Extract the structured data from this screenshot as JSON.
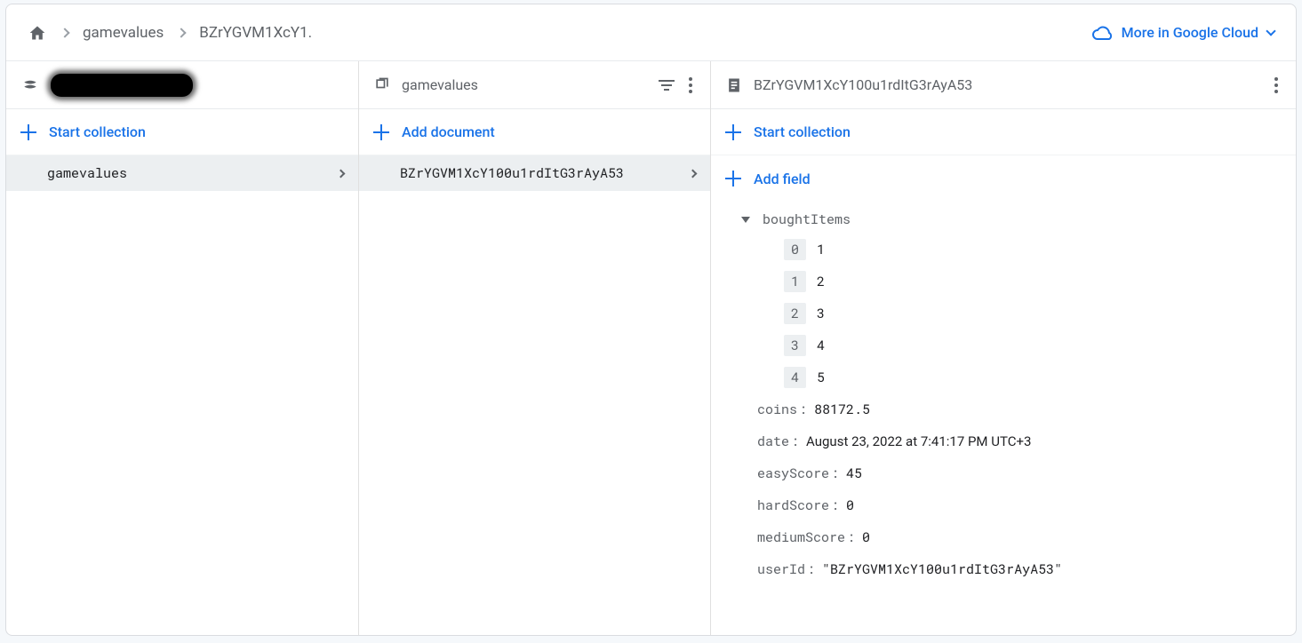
{
  "breadcrumb": {
    "items": [
      "gamevalues",
      "BZrYGVM1XcY1."
    ],
    "more_label": "More in Google Cloud"
  },
  "col1": {
    "action": "Start collection",
    "items": [
      {
        "label": "gamevalues",
        "selected": true
      }
    ]
  },
  "col2": {
    "title": "gamevalues",
    "action": "Add document",
    "items": [
      {
        "label": "BZrYGVM1XcY100u1rdItG3rAyA53",
        "selected": true
      }
    ]
  },
  "col3": {
    "title": "BZrYGVM1XcY100u1rdItG3rAyA53",
    "action_collection": "Start collection",
    "action_field": "Add field",
    "doc": {
      "boughtItems_key": "boughtItems",
      "boughtItems": [
        {
          "index": "0",
          "value": "1"
        },
        {
          "index": "1",
          "value": "2"
        },
        {
          "index": "2",
          "value": "3"
        },
        {
          "index": "3",
          "value": "4"
        },
        {
          "index": "4",
          "value": "5"
        }
      ],
      "fields": [
        {
          "key": "coins",
          "value": "88172.5",
          "mono": true
        },
        {
          "key": "date",
          "value": "August 23, 2022 at 7:41:17 PM UTC+3",
          "mono": false
        },
        {
          "key": "easyScore",
          "value": "45",
          "mono": true
        },
        {
          "key": "hardScore",
          "value": "0",
          "mono": true
        },
        {
          "key": "mediumScore",
          "value": "0",
          "mono": true
        },
        {
          "key": "userId",
          "value": "\"BZrYGVM1XcY100u1rdItG3rAyA53\"",
          "mono": true
        }
      ]
    }
  }
}
